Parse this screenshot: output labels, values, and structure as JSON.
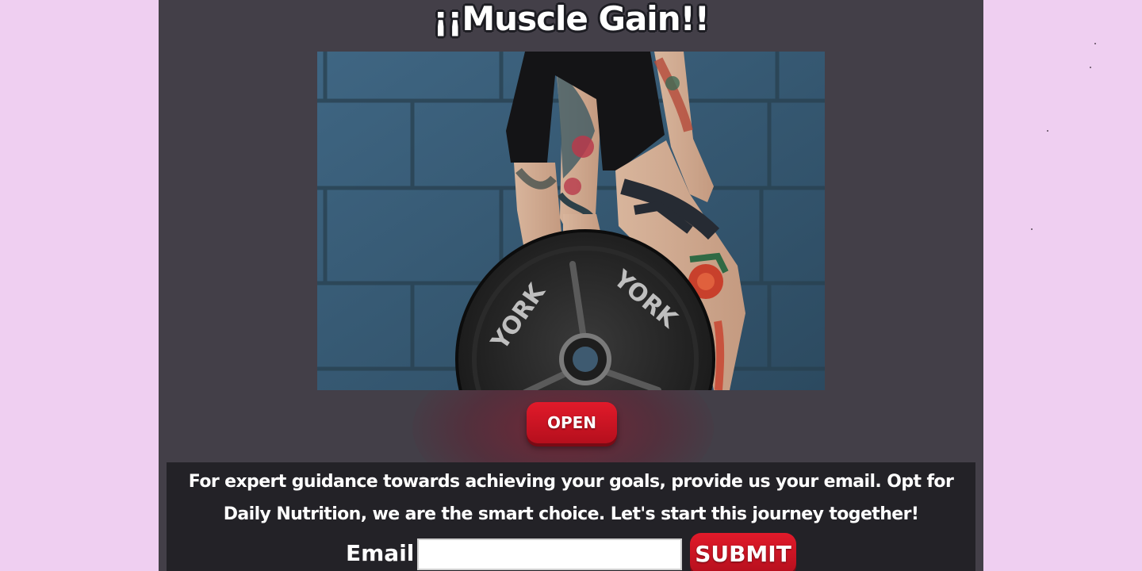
{
  "page": {
    "title": "¡¡Muscle Gain!!"
  },
  "hero": {
    "image_name": "tattooed-athlete-weight-plate-photo",
    "plate_text": "YORK"
  },
  "open_button": {
    "label": "OPEN"
  },
  "signup": {
    "text": "For expert guidance towards achieving your goals, provide us your email. Opt for Daily Nutrition, we are the smart choice. Let's start this journey together!",
    "email_label": "Email",
    "email_value": "",
    "email_placeholder": "",
    "submit_label": "SUBMIT"
  },
  "colors": {
    "side_background": "#efcff1",
    "main_background": "#433f48",
    "signup_background": "#232227",
    "button_red": "#d0141f",
    "text_white": "#ffffff"
  }
}
